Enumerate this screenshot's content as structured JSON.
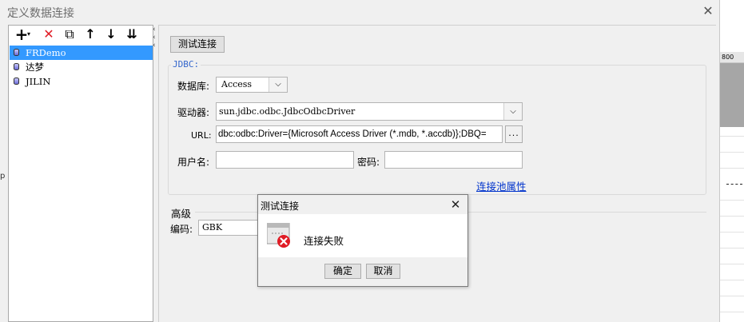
{
  "dialog": {
    "title": "定义数据连接",
    "close_glyph": "✕"
  },
  "toolbar": {
    "add_glyph": "+",
    "add_caret": "▾",
    "delete_glyph": "✕",
    "copy_glyph": "⧉",
    "up_glyph": "↑",
    "down_glyph": "↓",
    "sort_glyph": "⇊"
  },
  "connections": [
    {
      "name": "FRDemo",
      "selected": true
    },
    {
      "name": "达梦",
      "selected": false
    },
    {
      "name": "JILIN",
      "selected": false
    }
  ],
  "form": {
    "test_button": "测试连接",
    "group_label": "JDBC:",
    "db_label": "数据库:",
    "db_value": "Access",
    "driver_label": "驱动器:",
    "driver_value": "sun.jdbc.odbc.JdbcOdbcDriver",
    "url_label": "URL:",
    "url_value": "dbc:odbc:Driver={Microsoft Access Driver (*.mdb, *.accdb)};DBQ=",
    "url_more": "...",
    "user_label": "用户名:",
    "user_value": "",
    "pwd_label": "密码:",
    "pwd_value": "",
    "pool_link": "连接池属性",
    "advanced_label": "高级",
    "encoding_label": "编码:",
    "encoding_value": "GBK"
  },
  "modal": {
    "title": "测试连接",
    "message": "连接失败",
    "ok": "确定",
    "cancel": "取消",
    "close_glyph": "✕"
  },
  "background": {
    "ruler_label": "800"
  },
  "colors": {
    "selection": "#3399ff",
    "link": "#0033cc",
    "error": "#e01b24"
  }
}
